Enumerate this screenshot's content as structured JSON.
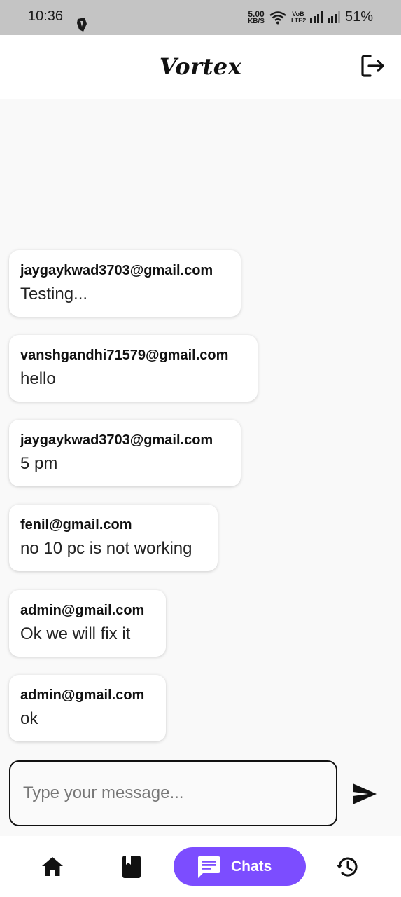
{
  "status_bar": {
    "time": "10:36",
    "speed_value": "5.00",
    "speed_unit": "KB/S",
    "volte_label": "VoB LTE2",
    "battery": "51%"
  },
  "app_bar": {
    "title": "Vortex",
    "logout_icon": "logout-icon"
  },
  "messages": [
    {
      "sender": "jaygaykwad3703@gmail.com",
      "text": "Testing..."
    },
    {
      "sender": "vanshgandhi71579@gmail.com",
      "text": "hello"
    },
    {
      "sender": "jaygaykwad3703@gmail.com",
      "text": "5 pm"
    },
    {
      "sender": "fenil@gmail.com",
      "text": "no 10 pc is not working"
    },
    {
      "sender": "admin@gmail.com",
      "text": "Ok we will fix it"
    },
    {
      "sender": "admin@gmail.com",
      "text": "ok"
    }
  ],
  "composer": {
    "placeholder": "Type your message...",
    "value": "",
    "send_icon": "send-icon"
  },
  "bottom_nav": {
    "items": [
      {
        "icon": "home-icon"
      },
      {
        "icon": "book-icon"
      },
      {
        "icon": "chat-icon",
        "label": "Chats",
        "active": true
      },
      {
        "icon": "history-icon"
      }
    ]
  },
  "colors": {
    "accent": "#7c4dff",
    "status_bar": "#c4c4c4",
    "background": "#f9f9f9"
  }
}
